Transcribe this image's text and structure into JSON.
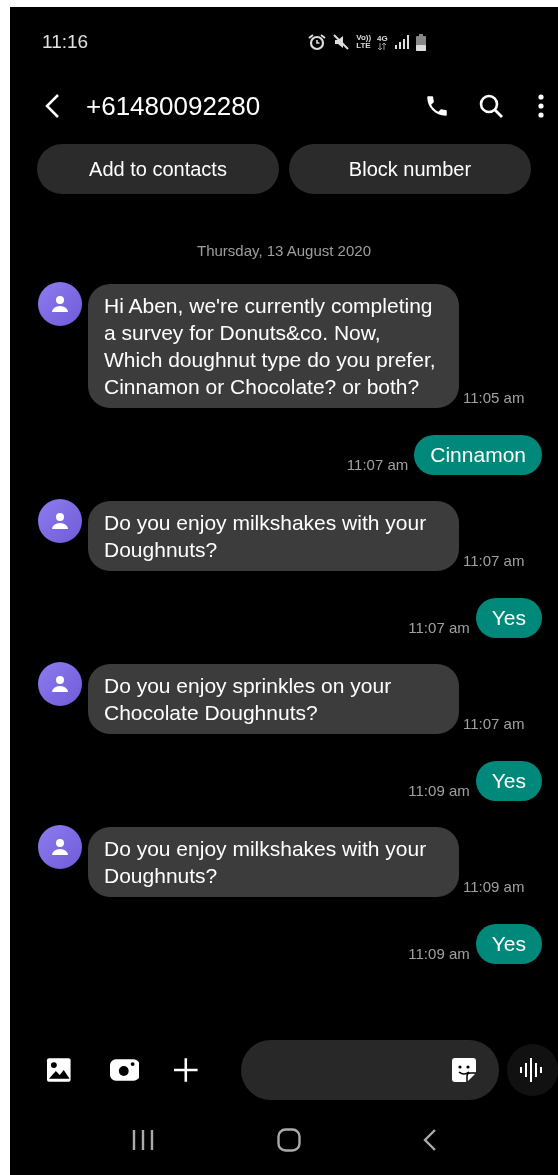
{
  "status_bar": {
    "time": "11:16",
    "network_labels": [
      "Vo))",
      "LTE",
      "4G"
    ]
  },
  "header": {
    "title": "+61480092280"
  },
  "actions": [
    "Add to contacts",
    "Block number"
  ],
  "date_divider": "Thursday, 13 August 2020",
  "messages": [
    {
      "kind": "incoming",
      "text": "Hi Aben, we're currently completing a survey for Donuts&co. Now, Which doughnut type do you prefer, Cinnamon or Chocolate? or both?",
      "time": "11:05 am"
    },
    {
      "kind": "outgoing",
      "text": "Cinnamon",
      "time": "11:07 am"
    },
    {
      "kind": "incoming",
      "text": "Do you enjoy milkshakes with your Doughnuts?",
      "time": "11:07 am"
    },
    {
      "kind": "outgoing",
      "text": "Yes",
      "time": "11:07 am"
    },
    {
      "kind": "incoming",
      "text": "Do you enjoy sprinkles on your Chocolate Doughnuts?",
      "time": "11:07 am"
    },
    {
      "kind": "outgoing",
      "text": "Yes",
      "time": "11:09 am"
    },
    {
      "kind": "incoming",
      "text": "Do you enjoy milkshakes with your Doughnuts?",
      "time": "11:09 am"
    },
    {
      "kind": "outgoing",
      "text": "Yes",
      "time": "11:09 am"
    }
  ]
}
